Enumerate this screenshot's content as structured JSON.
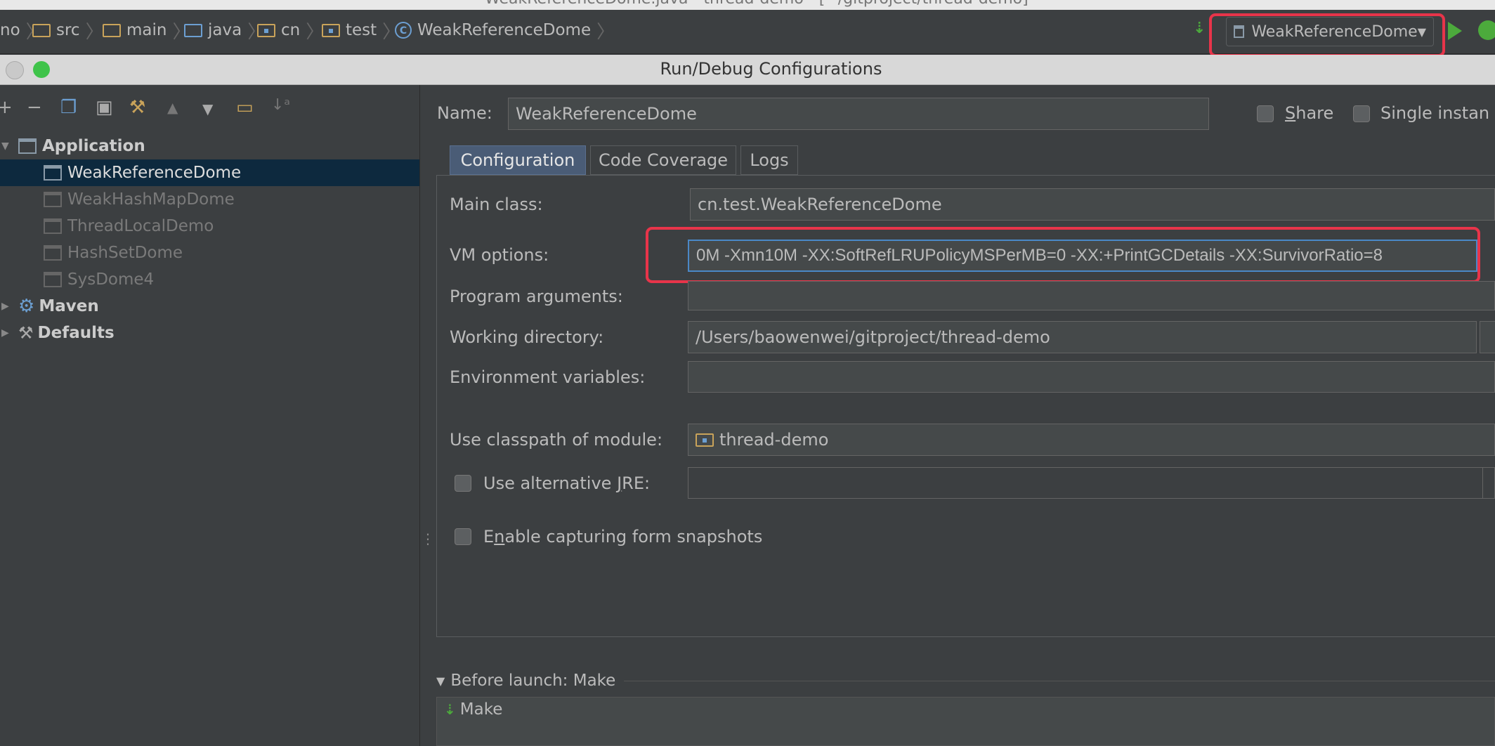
{
  "window": {
    "title": "WeakReferenceDome.java - thread-demo - [~/gitproject/thread-demo]"
  },
  "breadcrumbs": [
    {
      "label": "no",
      "icon": "none"
    },
    {
      "label": "src",
      "icon": "folder-icon"
    },
    {
      "label": "main",
      "icon": "folder-icon"
    },
    {
      "label": "java",
      "icon": "source-folder-icon"
    },
    {
      "label": "cn",
      "icon": "package-icon"
    },
    {
      "label": "test",
      "icon": "package-icon"
    },
    {
      "label": "WeakReferenceDome",
      "icon": "class-icon"
    }
  ],
  "run_config": {
    "selected": "WeakReferenceDome"
  },
  "dialog": {
    "title": "Run/Debug Configurations"
  },
  "tree": {
    "groups": [
      {
        "label": "Application",
        "icon": "application-icon",
        "expanded": true
      },
      {
        "label": "Maven",
        "icon": "maven-gear-icon",
        "expanded": false
      },
      {
        "label": "Defaults",
        "icon": "defaults-wrench-icon",
        "expanded": false
      }
    ],
    "items": [
      {
        "label": "WeakReferenceDome",
        "selected": true
      },
      {
        "label": "WeakHashMapDome",
        "selected": false
      },
      {
        "label": "ThreadLocalDemo",
        "selected": false
      },
      {
        "label": "HashSetDome",
        "selected": false
      },
      {
        "label": "SysDome4",
        "selected": false
      }
    ]
  },
  "form": {
    "name_label": "Name:",
    "name_value": "WeakReferenceDome",
    "share_label": "Share",
    "single_instance_label": "Single instan",
    "tabs": [
      {
        "label": "Configuration",
        "active": true
      },
      {
        "label": "Code Coverage",
        "active": false
      },
      {
        "label": "Logs",
        "active": false
      }
    ],
    "main_class_label": "Main class:",
    "main_class_value": "cn.test.WeakReferenceDome",
    "vm_options_label": "VM options:",
    "vm_options_value": "0M  -Xmn10M  -XX:SoftRefLRUPolicyMSPerMB=0  -XX:+PrintGCDetails -XX:SurvivorRatio=8",
    "program_args_label": "Program arguments:",
    "program_args_value": "",
    "working_dir_label": "Working directory:",
    "working_dir_value": "/Users/baowenwei/gitproject/thread-demo",
    "env_vars_label": "Environment variables:",
    "env_vars_value": "",
    "classpath_label": "Use classpath of module:",
    "classpath_value": "thread-demo",
    "alt_jre_label_pre": "Use alternative ",
    "alt_jre_label_u": "J",
    "alt_jre_label_post": "RE:",
    "snapshots_label_pre": "E",
    "snapshots_label_u": "n",
    "snapshots_label_post": "able capturing form snapshots",
    "share_u": "S",
    "share_rest": "hare"
  },
  "before_launch": {
    "header": "Before launch: Make",
    "items": [
      {
        "label": "Make"
      }
    ]
  },
  "colors": {
    "background": "#3c3f41",
    "selection": "#0d293e",
    "highlight_box": "#e8344a",
    "run_green": "#4caa3c",
    "active_tab": "#4a5c76"
  }
}
